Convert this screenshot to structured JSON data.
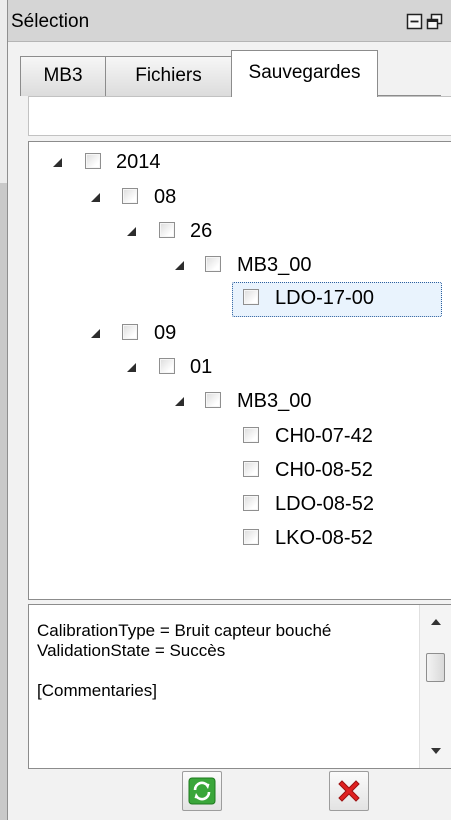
{
  "panel": {
    "title": "Sélection",
    "title_buttons": [
      {
        "icon": "minimize-icon"
      },
      {
        "icon": "float-restore-icon"
      }
    ]
  },
  "tabs": [
    {
      "label": "MB3",
      "active": false
    },
    {
      "label": "Fichiers",
      "active": false
    },
    {
      "label": "Sauvegardes",
      "active": true
    }
  ],
  "filter": {
    "value": "",
    "placeholder": ""
  },
  "tree": {
    "nodes": [
      {
        "label": "2014",
        "depth": 0,
        "expanded": true,
        "checked": false
      },
      {
        "label": "08",
        "depth": 1,
        "expanded": true,
        "checked": false
      },
      {
        "label": "26",
        "depth": 2,
        "expanded": true,
        "checked": false
      },
      {
        "label": "MB3_00",
        "depth": 3,
        "expanded": true,
        "checked": false
      },
      {
        "label": "LDO-17-00",
        "depth": 4,
        "checked": false,
        "focused": true
      },
      {
        "label": "09",
        "depth": 1,
        "expanded": true,
        "checked": false
      },
      {
        "label": "01",
        "depth": 2,
        "expanded": true,
        "checked": false
      },
      {
        "label": "MB3_00",
        "depth": 3,
        "expanded": true,
        "checked": false
      },
      {
        "label": "CH0-07-42",
        "depth": 4,
        "checked": false
      },
      {
        "label": "CH0-08-52",
        "depth": 4,
        "checked": false
      },
      {
        "label": "LDO-08-52",
        "depth": 4,
        "checked": false
      },
      {
        "label": "LKO-08-52",
        "depth": 4,
        "checked": false
      }
    ]
  },
  "details": {
    "text": "CalibrationType = Bruit capteur bouché\nValidationState = Succès\n\n[Commentaries]"
  },
  "actions": [
    {
      "icon": "refresh-icon",
      "color": "#3aa63a"
    },
    {
      "icon": "delete-icon",
      "color": "#e02020"
    }
  ]
}
